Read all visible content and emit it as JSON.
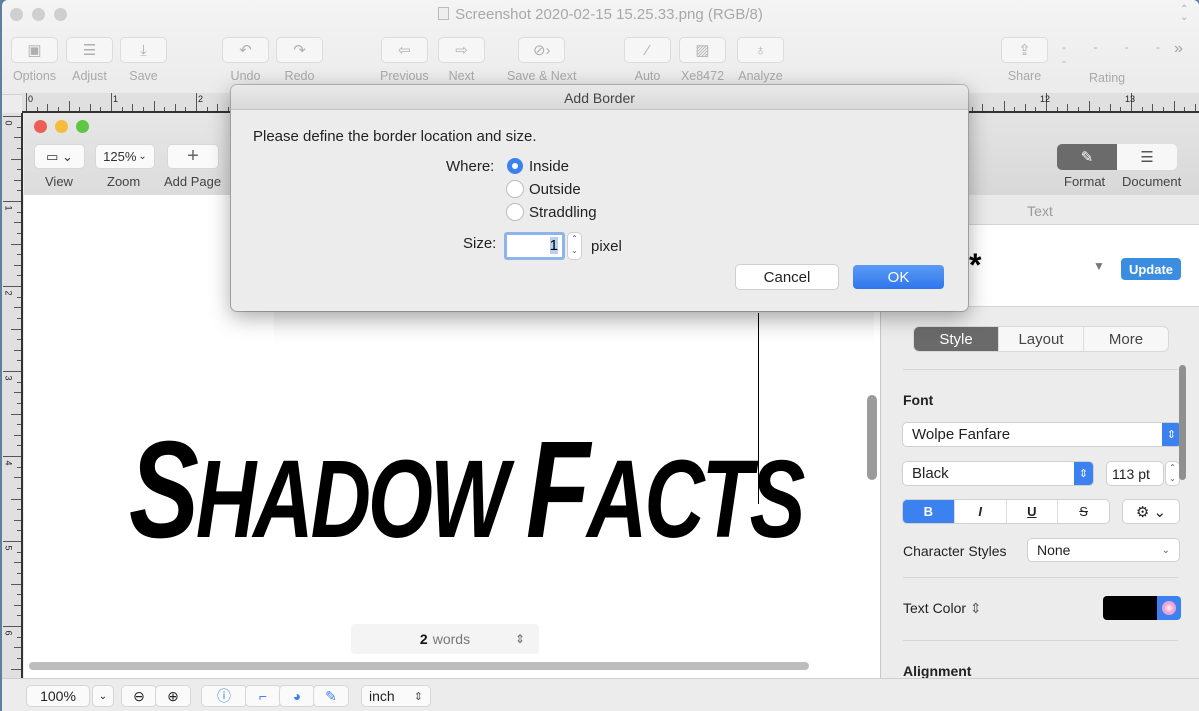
{
  "window": {
    "title": "Screenshot 2020-02-15 15.25.33.png (RGB/8)",
    "toolbar": [
      {
        "label": "Options",
        "icon": "options-icon"
      },
      {
        "label": "Adjust",
        "icon": "adjust-icon"
      },
      {
        "label": "Save",
        "icon": "save-icon"
      },
      {
        "label": "Undo",
        "icon": "undo-icon"
      },
      {
        "label": "Redo",
        "icon": "redo-icon"
      },
      {
        "label": "Previous",
        "icon": "previous-icon"
      },
      {
        "label": "Next",
        "icon": "next-icon"
      },
      {
        "label": "Save & Next",
        "icon": "save-next-icon"
      },
      {
        "label": "Auto",
        "icon": "magic-wand-icon"
      },
      {
        "label": "Xe8472",
        "icon": "image-icon"
      },
      {
        "label": "Analyze",
        "icon": "lightbulb-icon"
      },
      {
        "label": "Share",
        "icon": "share-icon"
      },
      {
        "label": "Rating",
        "icon": "rating-dots"
      }
    ],
    "rating_dots": "- - - - -",
    "overflow": "»"
  },
  "rulers": {
    "horizontal_left": [
      "0",
      "1",
      "2"
    ],
    "horizontal_right": [
      "12",
      "13"
    ],
    "vertical": [
      "0",
      "1",
      "2",
      "3",
      "4",
      "5",
      "6"
    ]
  },
  "doc_window": {
    "toolbar": {
      "view_label": "View",
      "zoom_value": "125%",
      "zoom_label": "Zoom",
      "add_page_label": "Add Page"
    },
    "content_text_parts": [
      "S",
      "HADOW ",
      "F",
      "ACTS"
    ],
    "word_count": {
      "number": "2",
      "unit": "words"
    },
    "sidebar": {
      "format_label": "Format",
      "document_label": "Document",
      "section_title": "Text",
      "paragraph_style_glyph": "*",
      "update_label": "Update",
      "tabs": [
        "Style",
        "Layout",
        "More"
      ],
      "active_tab": "Style",
      "font_heading": "Font",
      "font_family": "Wolpe Fanfare",
      "font_weight": "Black",
      "font_size": "113 pt",
      "format_buttons": [
        "B",
        "I",
        "U",
        "S"
      ],
      "active_format": "B",
      "character_styles_label": "Character Styles",
      "character_styles_value": "None",
      "text_color_label": "Text Color",
      "text_color": "#000000",
      "alignment_label": "Alignment"
    }
  },
  "dialog": {
    "title": "Add Border",
    "prompt": "Please define the border location and size.",
    "where_label": "Where:",
    "options": [
      "Inside",
      "Outside",
      "Straddling"
    ],
    "selected": "Inside",
    "size_label": "Size:",
    "size_value": "1",
    "size_unit": "pixel",
    "cancel_label": "Cancel",
    "ok_label": "OK"
  },
  "statusbar": {
    "zoom_value": "100%",
    "unit_value": "inch"
  },
  "colors": {
    "accent": "#3b82f0",
    "update_button": "#3b8de0"
  }
}
